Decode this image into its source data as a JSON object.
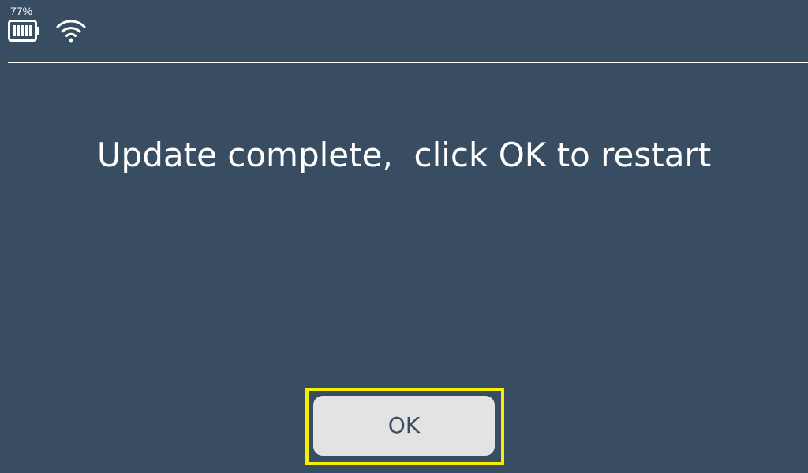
{
  "status_bar": {
    "battery_percent": "77%",
    "battery_icon": "battery-icon",
    "wifi_icon": "wifi-icon"
  },
  "dialog": {
    "message": "Update complete,  click OK to restart",
    "ok_label": "OK"
  },
  "colors": {
    "background": "#384c62",
    "text": "#ffffff",
    "button_bg": "#e3e3e3",
    "button_text": "#384c62",
    "highlight": "#f7ef00"
  }
}
